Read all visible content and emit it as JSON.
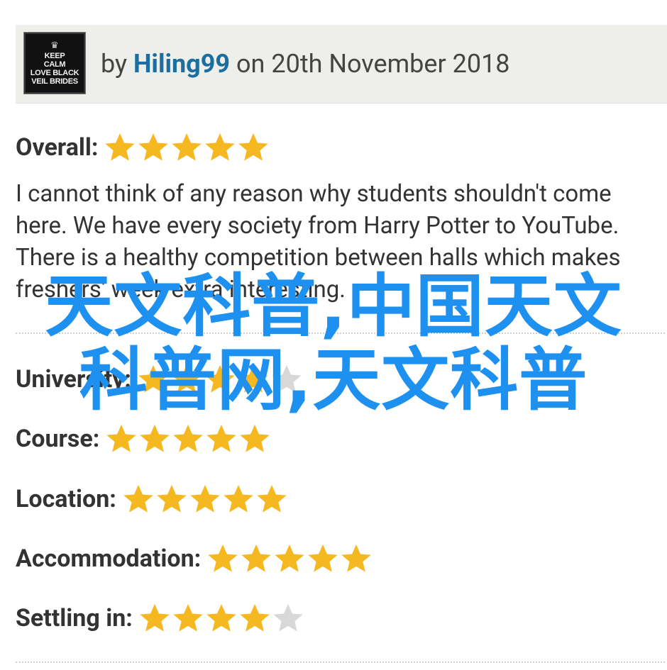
{
  "review": {
    "avatar_lines": [
      "KEEP",
      "CALM",
      "LOVE BLACK",
      "VEIL BRIDES"
    ],
    "by_prefix": "by",
    "author": "Hiling99",
    "on_text": "on",
    "date": "20th November 2018",
    "overall": {
      "label": "Overall:",
      "stars": 5,
      "max": 5
    },
    "text": "I cannot think of any reason why students shouldn't come here. We have every society from Harry Potter to YouTube. There is a healthy competition between halls which makes freshers' week extra interesting.",
    "ratings": [
      {
        "label": "University:",
        "stars": 4,
        "max": 5
      },
      {
        "label": "Course:",
        "stars": 5,
        "max": 5
      },
      {
        "label": "Location:",
        "stars": 5,
        "max": 5
      },
      {
        "label": "Accommodation:",
        "stars": 5,
        "max": 5
      },
      {
        "label": "Settling in:",
        "stars": 4,
        "max": 5
      }
    ]
  },
  "watermark": {
    "line1": "天文科普,中国天文",
    "line2": "科普网,天文科普"
  },
  "colors": {
    "star_on": "#f5b820",
    "star_off": "#d8d8d8",
    "author": "#1a6fa0",
    "watermark": "#1e90f0"
  }
}
